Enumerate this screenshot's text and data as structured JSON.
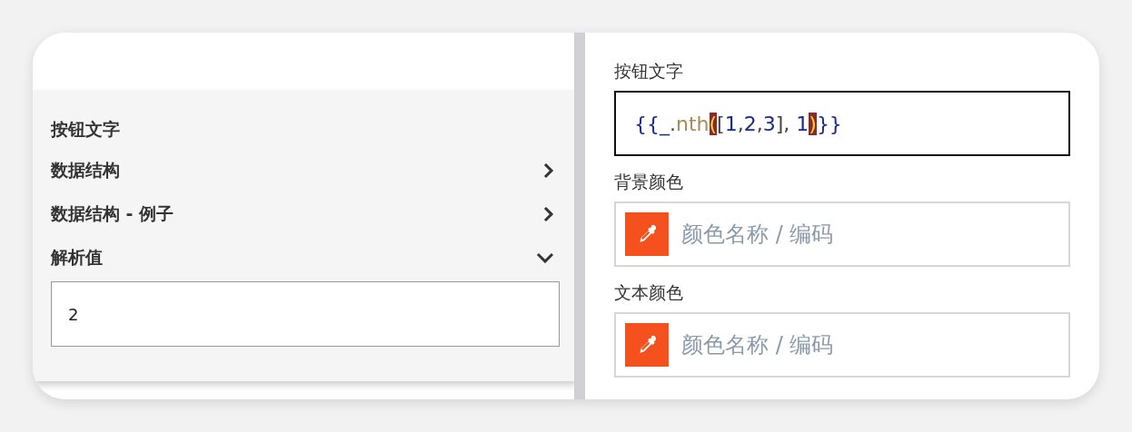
{
  "left_panel": {
    "title": "按钮文字",
    "sections": [
      {
        "label": "数据结构",
        "expanded": false
      },
      {
        "label": "数据结构 - 例子",
        "expanded": false
      },
      {
        "label": "解析值",
        "expanded": true,
        "value": "2"
      }
    ]
  },
  "right_panel": {
    "fields": [
      {
        "label": "按钮文字",
        "kind": "code",
        "tokens": [
          {
            "text": "{{",
            "kind": "brace"
          },
          {
            "text": "_",
            "kind": "var"
          },
          {
            "text": ".",
            "kind": "punct"
          },
          {
            "text": "nth",
            "kind": "func"
          },
          {
            "text": "(",
            "kind": "match"
          },
          {
            "text": "[",
            "kind": "punct"
          },
          {
            "text": "1",
            "kind": "number"
          },
          {
            "text": ",",
            "kind": "punct"
          },
          {
            "text": "2",
            "kind": "number"
          },
          {
            "text": ",",
            "kind": "punct"
          },
          {
            "text": "3",
            "kind": "number"
          },
          {
            "text": "], ",
            "kind": "punct"
          },
          {
            "text": "1",
            "kind": "number"
          },
          {
            "text": ")",
            "kind": "match"
          },
          {
            "text": "}}",
            "kind": "brace"
          }
        ]
      },
      {
        "label": "背景颜色",
        "kind": "color",
        "placeholder": "颜色名称 / 编码"
      },
      {
        "label": "文本颜色",
        "kind": "color",
        "placeholder": "颜色名称 / 编码"
      }
    ]
  }
}
